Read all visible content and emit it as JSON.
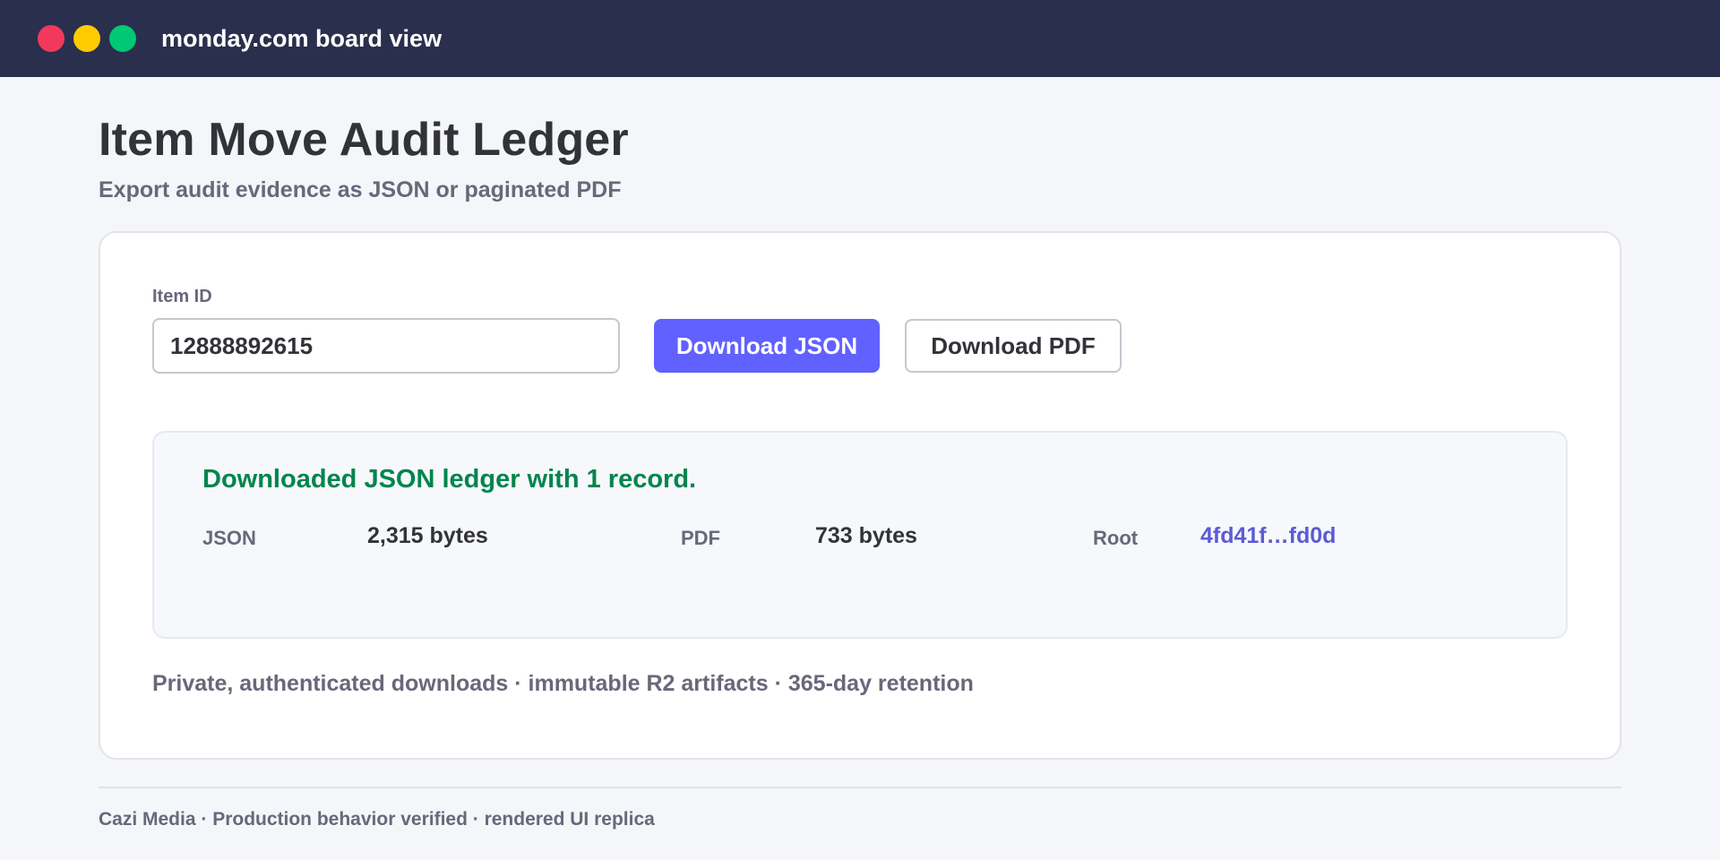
{
  "window": {
    "title": "monday.com board view",
    "controls": [
      "close-dot",
      "minimize-dot",
      "maximize-dot"
    ]
  },
  "page": {
    "title": "Item Move Audit Ledger",
    "subtitle": "Export audit evidence as JSON or paginated PDF"
  },
  "form": {
    "item_id_label": "Item ID",
    "item_id_value": "12888892615",
    "download_json_label": "Download JSON",
    "download_pdf_label": "Download PDF"
  },
  "result": {
    "message": "Downloaded JSON ledger with 1 record.",
    "json_label": "JSON",
    "json_value": "2,315 bytes",
    "pdf_label": "PDF",
    "pdf_value": "733 bytes",
    "root_label": "Root",
    "root_value": "4fd41f…fd0d"
  },
  "footnote": "Private, authenticated downloads · immutable R2 artifacts · 365-day retention",
  "footer": "Cazi Media · Production behavior verified · rendered UI replica",
  "colors": {
    "titlebar": "#292f4c",
    "primary": "#6161ff",
    "success": "#00854d",
    "link": "#5b5bd6"
  }
}
